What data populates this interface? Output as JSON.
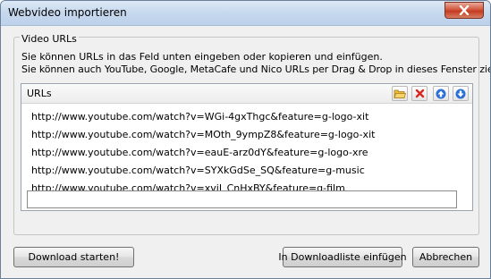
{
  "window": {
    "title": "Webvideo importieren"
  },
  "group": {
    "legend": "Video URLs",
    "info_line1": "Sie können URLs in das Feld unten eingeben oder kopieren und einfügen.",
    "info_line2": "Sie können auch YouTube, Google, MetaCafe und Nico URLs per Drag & Drop in dieses Fenster ziehen!"
  },
  "urls_panel": {
    "label": "URLs",
    "toolbar_icons": [
      "folder-open-icon",
      "delete-icon",
      "move-up-icon",
      "move-down-icon"
    ],
    "items": [
      "http://www.youtube.com/watch?v=WGi-4gxThgc&feature=g-logo-xit",
      "http://www.youtube.com/watch?v=MOth_9ympZ8&feature=g-logo-xit",
      "http://www.youtube.com/watch?v=eauE-arz0dY&feature=g-logo-xre",
      "http://www.youtube.com/watch?v=SYXkGdSe_SQ&feature=g-music",
      "http://www.youtube.com/watch?v=xvjI_CnHxBY&feature=g-film"
    ],
    "new_url_value": ""
  },
  "buttons": {
    "download": "Download starten!",
    "insert": "In Downloadliste einfügen",
    "cancel": "Abbrechen"
  },
  "colors": {
    "titlebar": "#c6d8ee",
    "close_button": "#c43a1f",
    "arrow_blue": "#2a6fd6",
    "delete_red": "#d9261c",
    "folder_yellow": "#e8b93a"
  }
}
